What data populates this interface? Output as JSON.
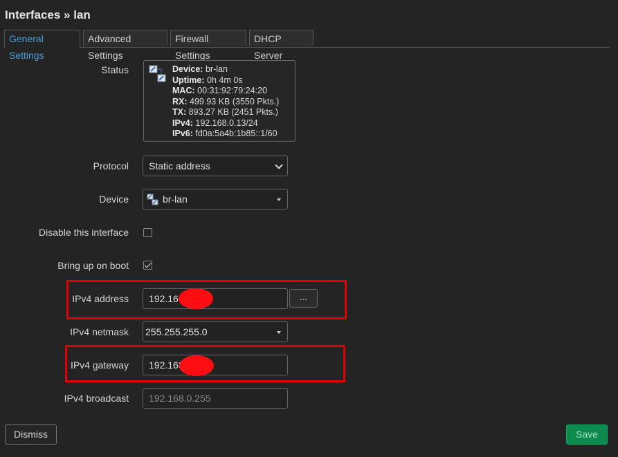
{
  "page": {
    "title": "Interfaces » lan"
  },
  "tabs": [
    {
      "label": "General Settings",
      "active": true
    },
    {
      "label": "Advanced Settings",
      "active": false
    },
    {
      "label": "Firewall Settings",
      "active": false
    },
    {
      "label": "DHCP Server",
      "active": false
    }
  ],
  "status": {
    "label": "Status",
    "icon": "network-device-icon",
    "lines": [
      {
        "key": "Device:",
        "value": "br-lan"
      },
      {
        "key": "Uptime:",
        "value": "0h 4m 0s"
      },
      {
        "key": "MAC:",
        "value": "00:31:92:79:24:20"
      },
      {
        "key": "RX:",
        "value": "499.93 KB (3550 Pkts.)"
      },
      {
        "key": "TX:",
        "value": "893.27 KB (2451 Pkts.)"
      },
      {
        "key": "IPv4:",
        "value": "192.168.0.13/24"
      },
      {
        "key": "IPv6:",
        "value": "fd0a:5a4b:1b85::1/60"
      }
    ]
  },
  "form": {
    "protocol": {
      "label": "Protocol",
      "value": "Static address"
    },
    "device": {
      "label": "Device",
      "value": "br-lan",
      "icon": "bridge-icon"
    },
    "disable_interface": {
      "label": "Disable this interface",
      "checked": false
    },
    "bring_up_on_boot": {
      "label": "Bring up on boot",
      "checked": true
    },
    "ipv4_address": {
      "label": "IPv4 address",
      "value": "192.168.",
      "button_label": "..."
    },
    "ipv4_netmask": {
      "label": "IPv4 netmask",
      "value": "255.255.255.0"
    },
    "ipv4_gateway": {
      "label": "IPv4 gateway",
      "value": "192.168."
    },
    "ipv4_broadcast": {
      "label": "IPv4 broadcast",
      "placeholder": "192.168.0.255"
    }
  },
  "buttons": {
    "dismiss": "Dismiss",
    "save": "Save"
  },
  "colors": {
    "accent": "#4a9fd8",
    "highlight": "#e30000",
    "save": "#0f8a4f",
    "background": "#242424"
  }
}
